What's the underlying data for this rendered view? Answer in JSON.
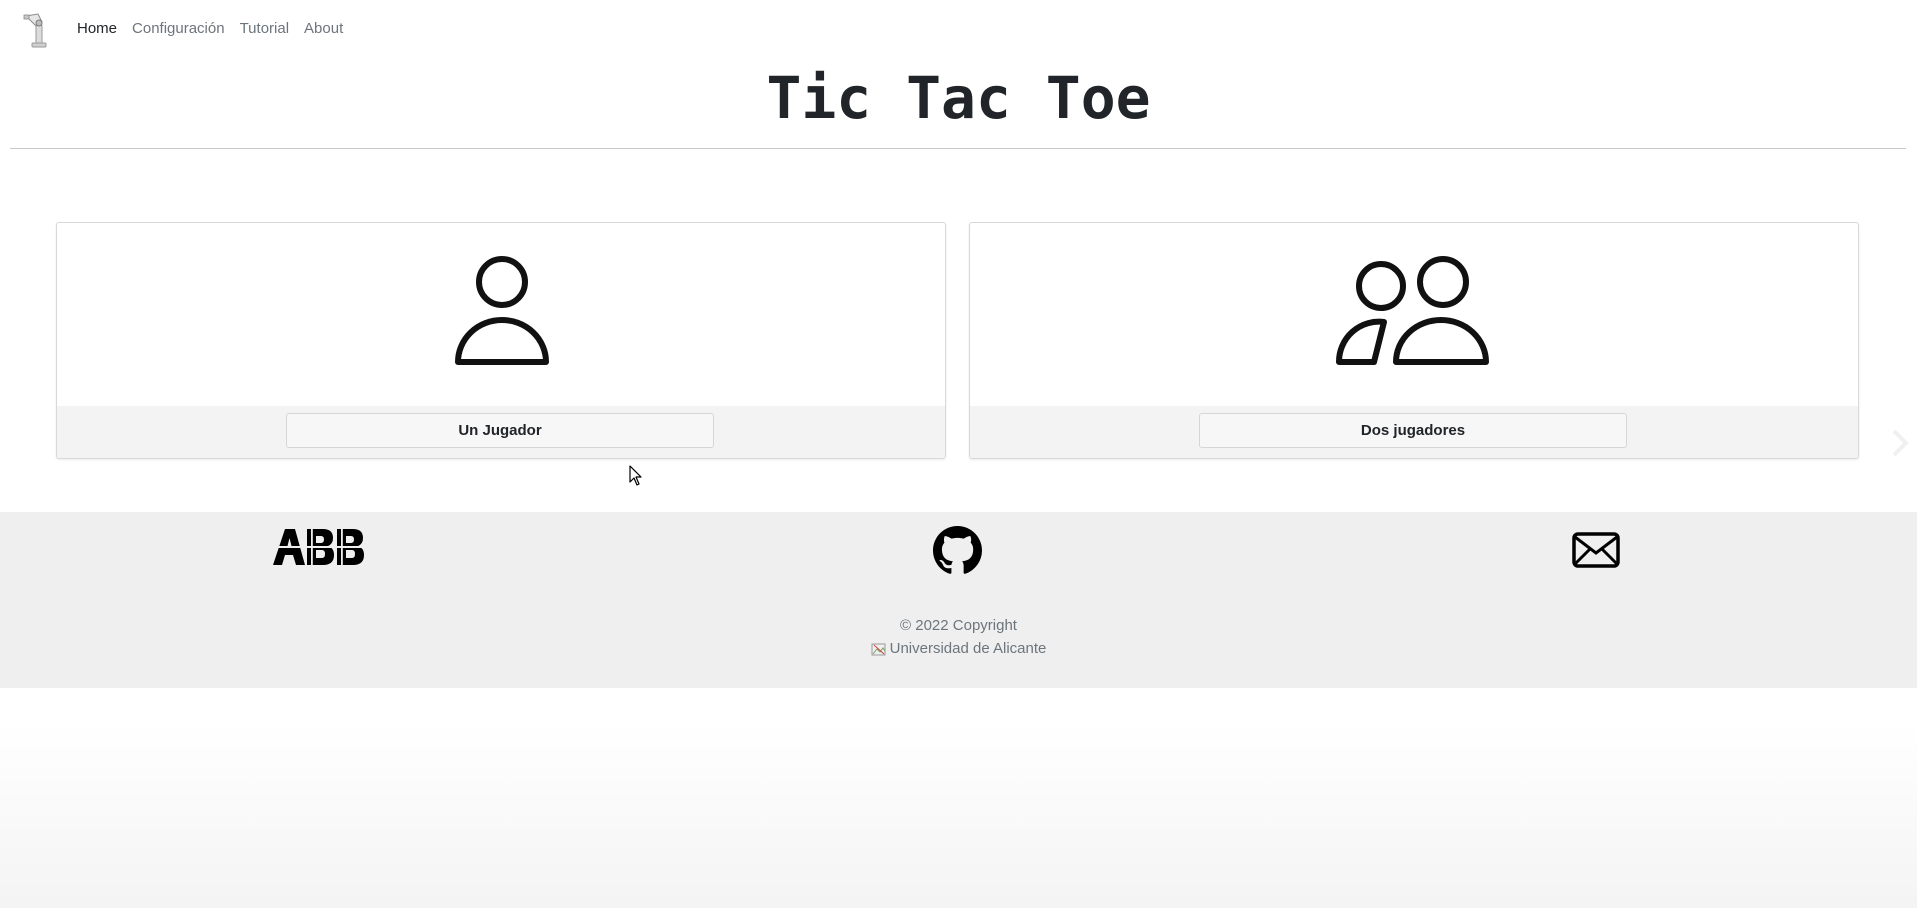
{
  "navbar": {
    "brand_icon": "robot-arm-icon",
    "links": [
      {
        "label": "Home",
        "active": true
      },
      {
        "label": "Configuración",
        "active": false
      },
      {
        "label": "Tutorial",
        "active": false
      },
      {
        "label": "About",
        "active": false
      }
    ]
  },
  "header": {
    "title": "Tic Tac Toe"
  },
  "modes": [
    {
      "icon": "single-person-icon",
      "button_label": "Un Jugador"
    },
    {
      "icon": "two-people-icon",
      "button_label": "Dos jugadores"
    }
  ],
  "footer": {
    "icons": [
      "abb-logo",
      "github-icon",
      "mail-icon"
    ],
    "copyright": "© 2022 Copyright",
    "university": "Universidad de Alicante"
  },
  "colors": {
    "text_dark": "#212529",
    "text_muted": "#6c757d",
    "footer_bg": "#efefef",
    "card_footer_bg": "#f3f3f3"
  }
}
